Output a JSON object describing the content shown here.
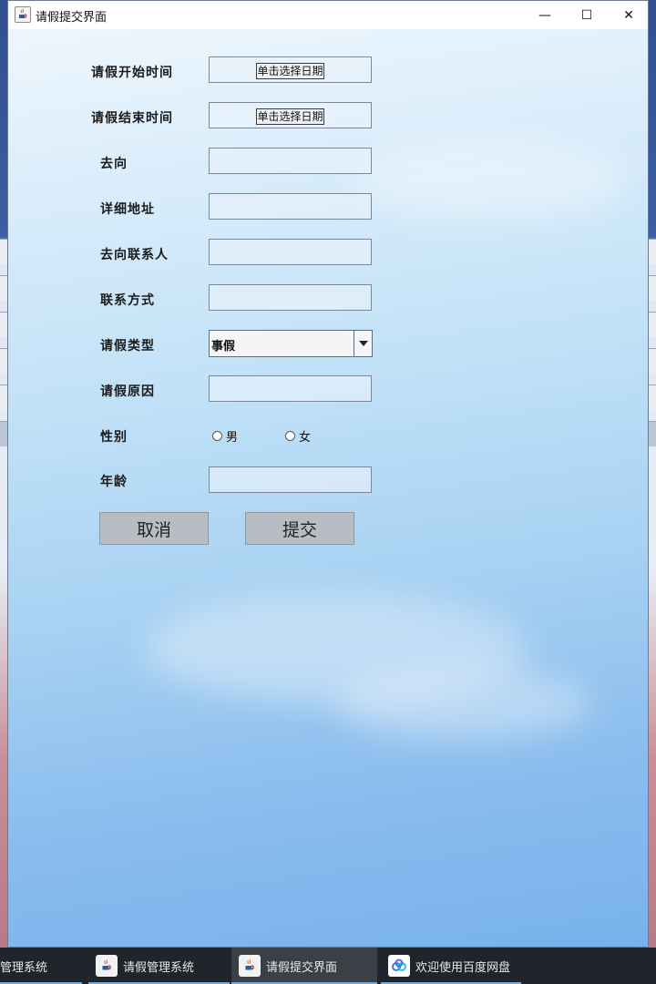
{
  "window": {
    "title": "请假提交界面",
    "minimize": "—",
    "maximize": "☐",
    "close": "✕"
  },
  "form": {
    "start_time": {
      "label": "请假开始时间",
      "button": "单击选择日期"
    },
    "end_time": {
      "label": "请假结束时间",
      "button": "单击选择日期"
    },
    "destination": {
      "label": "去向",
      "value": ""
    },
    "address": {
      "label": "详细地址",
      "value": ""
    },
    "contact_person": {
      "label": "去向联系人",
      "value": ""
    },
    "contact_method": {
      "label": "联系方式",
      "value": ""
    },
    "leave_type": {
      "label": "请假类型",
      "selected": "事假"
    },
    "reason": {
      "label": "请假原因",
      "value": ""
    },
    "gender": {
      "label": "性别",
      "options": [
        "男",
        "女"
      ]
    },
    "age": {
      "label": "年龄",
      "value": ""
    },
    "cancel_button": "取消",
    "submit_button": "提交"
  },
  "taskbar": {
    "items": [
      {
        "label": "管理系统"
      },
      {
        "label": "请假管理系统"
      },
      {
        "label": "请假提交界面"
      },
      {
        "label": "欢迎使用百度网盘"
      }
    ]
  }
}
